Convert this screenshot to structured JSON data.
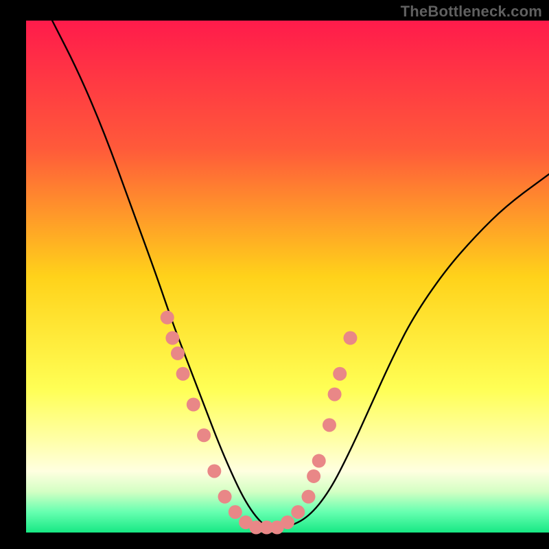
{
  "watermark": "TheBottleneck.com",
  "chart_data": {
    "type": "line",
    "title": "",
    "xlabel": "",
    "ylabel": "",
    "xlim": [
      0,
      100
    ],
    "ylim": [
      0,
      100
    ],
    "background_gradient": {
      "stops": [
        {
          "offset": 0,
          "color": "#ff1b4b"
        },
        {
          "offset": 25,
          "color": "#ff5a3a"
        },
        {
          "offset": 50,
          "color": "#ffd21a"
        },
        {
          "offset": 72,
          "color": "#ffff55"
        },
        {
          "offset": 82,
          "color": "#ffffa8"
        },
        {
          "offset": 88,
          "color": "#ffffe0"
        },
        {
          "offset": 92,
          "color": "#d4ffc4"
        },
        {
          "offset": 96,
          "color": "#66ffb0"
        },
        {
          "offset": 100,
          "color": "#17e884"
        }
      ]
    },
    "series": [
      {
        "name": "bottleneck-curve",
        "x": [
          5,
          10,
          15,
          20,
          25,
          28,
          31,
          34,
          37,
          40,
          42,
          44,
          46,
          48,
          50,
          54,
          58,
          62,
          66,
          70,
          74,
          80,
          86,
          92,
          100
        ],
        "y": [
          100,
          90,
          78,
          64,
          50,
          41,
          33,
          25,
          17,
          10,
          6,
          3,
          1,
          1,
          1,
          3,
          8,
          16,
          25,
          34,
          42,
          51,
          58,
          64,
          70
        ]
      }
    ],
    "markers": {
      "name": "sample-points",
      "color": "#e98787",
      "radius": 10,
      "points": [
        {
          "x": 27,
          "y": 42
        },
        {
          "x": 28,
          "y": 38
        },
        {
          "x": 29,
          "y": 35
        },
        {
          "x": 30,
          "y": 31
        },
        {
          "x": 32,
          "y": 25
        },
        {
          "x": 34,
          "y": 19
        },
        {
          "x": 36,
          "y": 12
        },
        {
          "x": 38,
          "y": 7
        },
        {
          "x": 40,
          "y": 4
        },
        {
          "x": 42,
          "y": 2
        },
        {
          "x": 44,
          "y": 1
        },
        {
          "x": 46,
          "y": 1
        },
        {
          "x": 48,
          "y": 1
        },
        {
          "x": 50,
          "y": 2
        },
        {
          "x": 52,
          "y": 4
        },
        {
          "x": 54,
          "y": 7
        },
        {
          "x": 55,
          "y": 11
        },
        {
          "x": 56,
          "y": 14
        },
        {
          "x": 58,
          "y": 21
        },
        {
          "x": 59,
          "y": 27
        },
        {
          "x": 60,
          "y": 31
        },
        {
          "x": 62,
          "y": 38
        }
      ]
    }
  }
}
